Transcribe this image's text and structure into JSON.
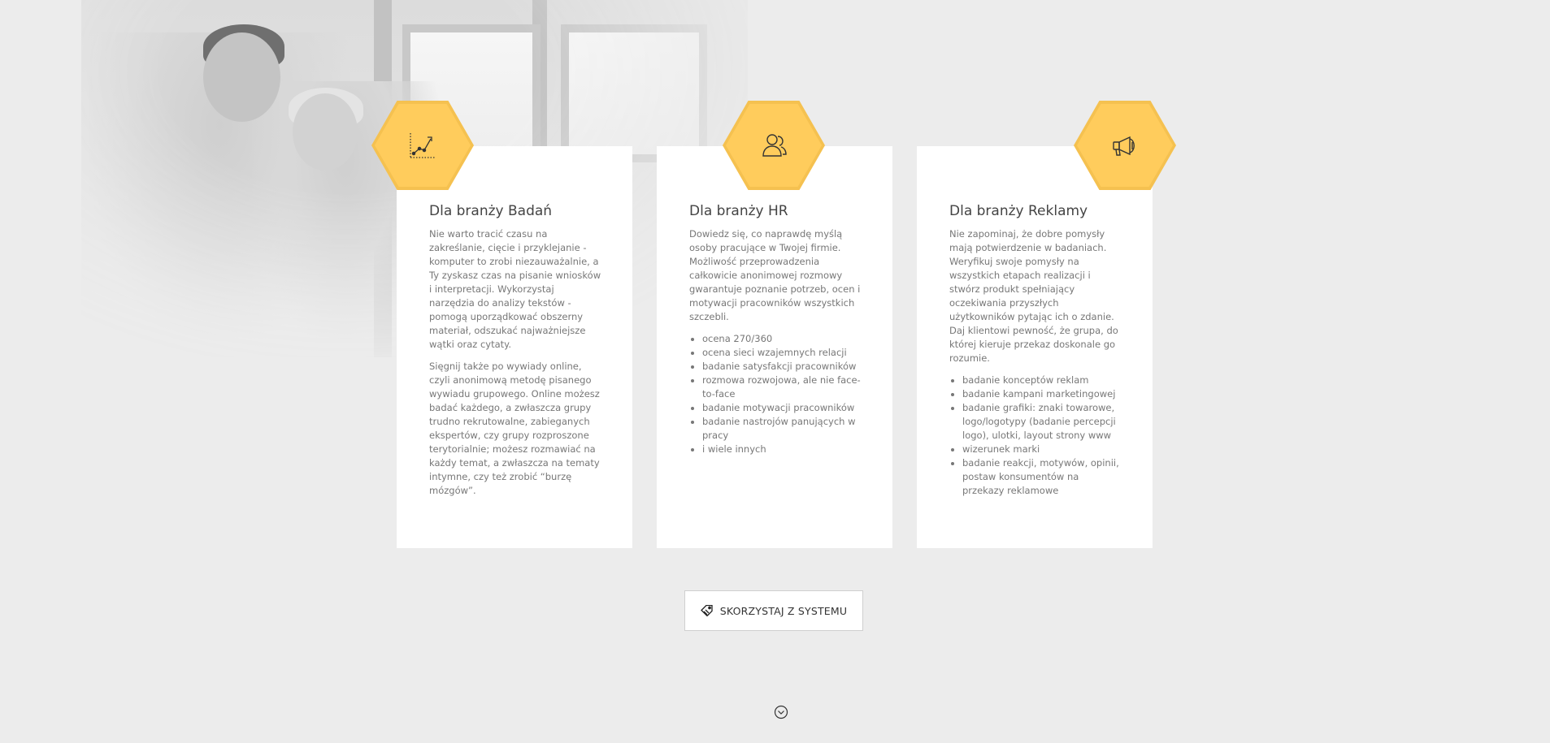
{
  "accent_color": "#ffcc5c",
  "cards": [
    {
      "icon": "growth-chart-icon",
      "title": "Dla branży Badań",
      "paragraphs": [
        "Nie warto tracić czasu na zakreślanie, cięcie i przyklejanie - komputer to zrobi niezauważalnie, a Ty zyskasz czas na pisanie wniosków i interpretacji. Wykorzystaj narzędzia do analizy tekstów - pomogą uporządkować obszerny materiał, odszukać najważniejsze wątki oraz cytaty.",
        "Sięgnij także po wywiady online, czyli anonimową metodę pisanego wywiadu grupowego. Online możesz badać każdego, a zwłaszcza grupy trudno rekrutowalne, zabieganych ekspertów, czy grupy rozproszone terytorialnie; możesz rozmawiać na każdy temat, a zwłaszcza na tematy intymne, czy też zrobić “burzę mózgów”."
      ],
      "items": []
    },
    {
      "icon": "people-icon",
      "title": "Dla branży HR",
      "paragraphs": [
        "Dowiedz się, co naprawdę myślą osoby pracujące w Twojej firmie. Możliwość przeprowadzenia całkowicie anonimowej rozmowy gwarantuje poznanie potrzeb, ocen i motywacji pracowników wszystkich szczebli."
      ],
      "items": [
        "ocena 270/360",
        "ocena sieci wzajemnych relacji",
        "badanie satysfakcji pracowników",
        "rozmowa rozwojowa, ale nie face-to-face",
        "badanie motywacji pracowników",
        "badanie nastrojów panujących w pracy",
        "i wiele innych"
      ]
    },
    {
      "icon": "megaphone-icon",
      "title": "Dla branży Reklamy",
      "paragraphs": [
        "Nie zapominaj, że dobre pomysły mają potwierdzenie w badaniach. Weryfikuj swoje pomysły na wszystkich etapach realizacji i stwórz produkt spełniający oczekiwania przyszłych użytkowników pytając ich o zdanie. Daj klientowi pewność, że grupa, do której kieruje przekaz doskonale go rozumie."
      ],
      "items": [
        "badanie konceptów reklam",
        "badanie kampani marketingowej",
        "badanie grafiki: znaki towarowe, logo/logotypy (badanie percepcji logo), ulotki, layout strony www",
        "wizerunek marki",
        "badanie reakcji, motywów, opinii, postaw konsumentów na przekazy reklamowe"
      ]
    }
  ],
  "cta": {
    "icon": "tag-icon",
    "label": "SKORZYSTAJ Z SYSTEMU"
  },
  "scroll": {
    "icon": "chevron-down-circle-icon"
  }
}
